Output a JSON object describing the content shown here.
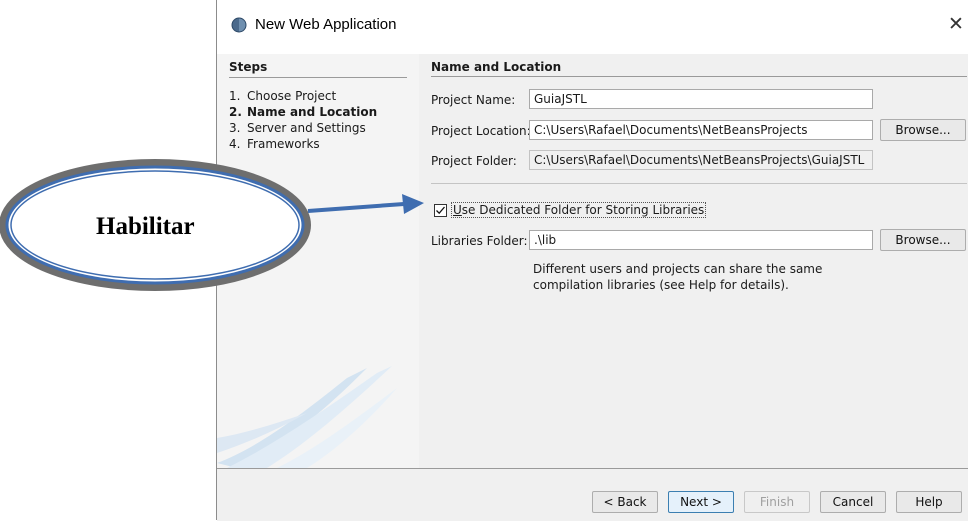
{
  "window": {
    "title": "New Web Application",
    "close_glyph": "✕",
    "icon": "globe-icon"
  },
  "steps": {
    "title": "Steps",
    "items": [
      {
        "num": "1.",
        "label": "Choose Project"
      },
      {
        "num": "2.",
        "label": "Name and Location"
      },
      {
        "num": "3.",
        "label": "Server and Settings"
      },
      {
        "num": "4.",
        "label": "Frameworks"
      }
    ]
  },
  "section": {
    "title": "Name and Location",
    "project_name_label": "Project Name:",
    "project_name_value": "GuiaJSTL",
    "project_location_label": "Project Location:",
    "project_location_value": "C:\\Users\\Rafael\\Documents\\NetBeansProjects",
    "browse_label": "Browse...",
    "project_folder_label": "Project Folder:",
    "project_folder_value": "C:\\Users\\Rafael\\Documents\\NetBeansProjects\\GuiaJSTL",
    "dedicated_folder_label_mnemonic": "U",
    "dedicated_folder_label_rest": "se Dedicated Folder for Storing Libraries",
    "dedicated_folder_checked": true,
    "libraries_folder_label": "Libraries Folder:",
    "libraries_folder_value": ".\\lib",
    "hint_line1": "Different users and projects can share the same",
    "hint_line2": "compilation libraries (see Help for details)."
  },
  "buttons": {
    "back": "< Back",
    "next": "Next >",
    "finish": "Finish",
    "cancel": "Cancel",
    "help": "Help"
  },
  "annotation": {
    "text": "Habilitar"
  },
  "colors": {
    "annotation_blue": "#3f6db0",
    "disabled_text": "#a0a0a0",
    "focus_border": "#3c7fb1"
  }
}
